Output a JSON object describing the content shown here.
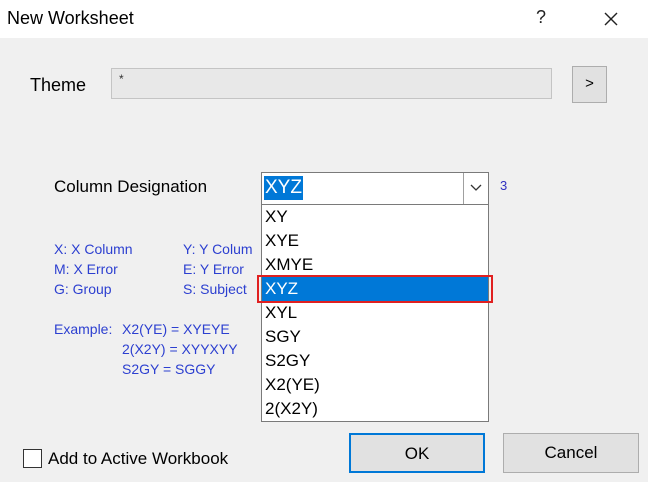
{
  "window": {
    "title": "New Worksheet",
    "help_label": "?",
    "close_icon": "close-icon"
  },
  "theme": {
    "label": "Theme",
    "value": "*",
    "browse_label": ">"
  },
  "column_designation": {
    "label": "Column Designation",
    "selected_value": "XYZ",
    "column_count": "3",
    "options": [
      "XY",
      "XYE",
      "XMYE",
      "XYZ",
      "XYL",
      "SGY",
      "S2GY",
      "X2(YE)",
      "2(X2Y)"
    ],
    "selected_index": 3
  },
  "legend": {
    "col1": "X: X Column\nM: X Error\nG: Group",
    "col2": "Y: Y Colum\nE: Y Error\nS: Subject",
    "example_label": "Example:",
    "examples": "X2(YE) = XYEYE\n2(X2Y) = XYYXYY\nS2GY = SGGY"
  },
  "footer": {
    "add_to_workbook_label": "Add to Active Workbook",
    "add_to_workbook_checked": false,
    "ok_label": "OK",
    "cancel_label": "Cancel"
  },
  "colors": {
    "accent": "#0078d7",
    "help_text": "#2c3fd0",
    "highlight": "#e02020"
  }
}
